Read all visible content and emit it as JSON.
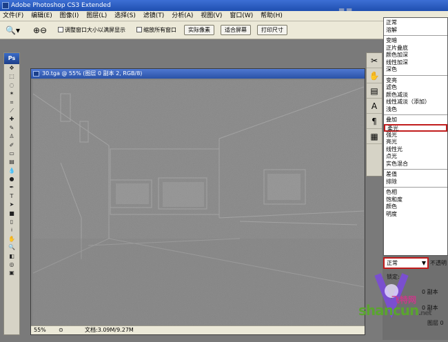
{
  "window": {
    "title": "Adobe Photoshop CS3 Extended"
  },
  "menu": [
    "文件(F)",
    "编辑(E)",
    "图像(I)",
    "图层(L)",
    "选择(S)",
    "滤镜(T)",
    "分析(A)",
    "视图(V)",
    "窗口(W)",
    "帮助(H)"
  ],
  "options": {
    "resize_windows": "调整窗口大小以满屏显示",
    "zoom_all": "缩放所有窗口",
    "actual_pixels": "实际像素",
    "fit_screen": "适合屏幕",
    "print_size": "打印尺寸"
  },
  "toolbox": {
    "logo": "Ps"
  },
  "document": {
    "title": "30.tga @ 55% (图层 0 副本 2, RGB/8)",
    "zoom": "55%",
    "doc_size": "文档:3.09M/9.27M"
  },
  "blend_modes": {
    "groups": [
      [
        "正常",
        "溶解"
      ],
      [
        "变暗",
        "正片叠底",
        "颜色加深",
        "线性加深",
        "深色"
      ],
      [
        "变亮",
        "滤色",
        "颜色减淡",
        "线性减淡（添加）",
        "浅色"
      ],
      [
        "叠加",
        "柔光",
        "强光",
        "亮光",
        "线性光",
        "点光",
        "实色混合"
      ],
      [
        "差值",
        "排除"
      ],
      [
        "色相",
        "饱和度",
        "颜色",
        "明度"
      ]
    ],
    "highlighted": "柔光",
    "current": "正常",
    "opacity_label": "不透明"
  },
  "layers": {
    "lock_label": "锁定:",
    "rows": [
      "0 副本",
      "0 副本",
      "图层 0"
    ]
  },
  "watermark": {
    "text": "shancun",
    "sub": "飞特网",
    "suffix": ".net"
  },
  "colors": {
    "accent_red": "#c11b1b",
    "title_blue": "#2a52a6",
    "panel": "#ece9d8"
  }
}
